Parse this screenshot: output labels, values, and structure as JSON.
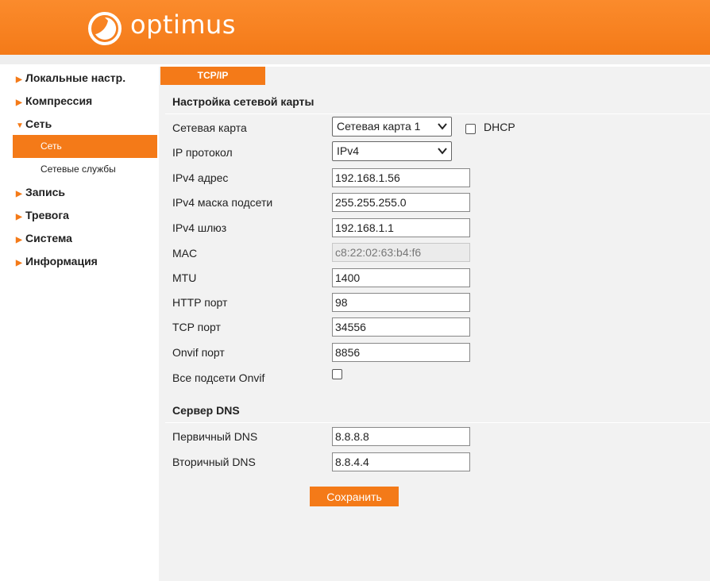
{
  "brand": {
    "name": "optimus",
    "color": "#f47a18"
  },
  "sidebar": {
    "items": [
      {
        "label": "Локальные настр.",
        "expanded": false
      },
      {
        "label": "Компрессия",
        "expanded": false
      },
      {
        "label": "Сеть",
        "expanded": true,
        "children": [
          {
            "label": "Сеть",
            "active": true
          },
          {
            "label": "Сетевые службы",
            "active": false
          }
        ]
      },
      {
        "label": "Запись",
        "expanded": false
      },
      {
        "label": "Тревога",
        "expanded": false
      },
      {
        "label": "Система",
        "expanded": false
      },
      {
        "label": "Информация",
        "expanded": false
      }
    ]
  },
  "main": {
    "tab": "TCP/IP",
    "network_section": {
      "title": "Настройка сетевой карты",
      "network_card": {
        "label": "Сетевая карта",
        "value": "Сетевая карта 1"
      },
      "dhcp": {
        "label": "DHCP",
        "checked": false
      },
      "ip_protocol": {
        "label": "IP протокол",
        "value": "IPv4"
      },
      "ipv4_address": {
        "label": "IPv4 адрес",
        "value": "192.168.1.56"
      },
      "ipv4_mask": {
        "label": "IPv4 маска подсети",
        "value": "255.255.255.0"
      },
      "ipv4_gateway": {
        "label": "IPv4 шлюз",
        "value": "192.168.1.1"
      },
      "mac": {
        "label": "MAC",
        "value": "c8:22:02:63:b4:f6"
      },
      "mtu": {
        "label": "MTU",
        "value": "1400"
      },
      "http_port": {
        "label": "HTTP порт",
        "value": "98"
      },
      "tcp_port": {
        "label": "TCP порт",
        "value": "34556"
      },
      "onvif_port": {
        "label": "Onvif порт",
        "value": "8856"
      },
      "onvif_all_subnets": {
        "label": "Все подсети Onvif",
        "checked": false
      }
    },
    "dns_section": {
      "title": "Сервер DNS",
      "primary": {
        "label": "Первичный DNS",
        "value": "8.8.8.8"
      },
      "secondary": {
        "label": "Вторичный DNS",
        "value": "8.8.4.4"
      }
    },
    "save_label": "Сохранить"
  }
}
